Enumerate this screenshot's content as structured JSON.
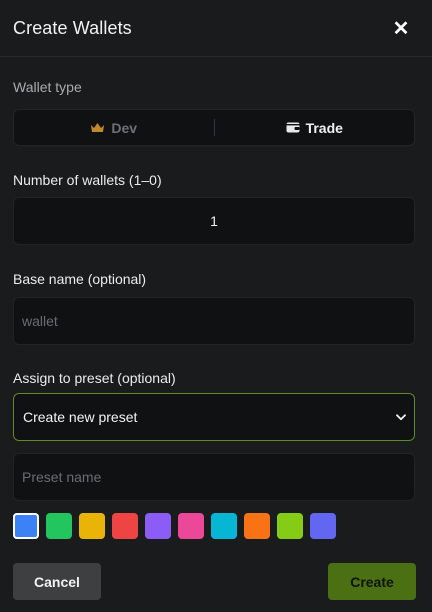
{
  "dialog": {
    "title": "Create Wallets",
    "close_label": "✕"
  },
  "wallet_type": {
    "label": "Wallet type",
    "options": [
      {
        "label": "Dev",
        "icon": "crown-icon",
        "selected": false
      },
      {
        "label": "Trade",
        "icon": "wallet-icon",
        "selected": true
      }
    ]
  },
  "count": {
    "label": "Number of wallets (1–0)",
    "value": "1"
  },
  "base_name": {
    "label": "Base name (optional)",
    "placeholder": "wallet",
    "value": ""
  },
  "preset": {
    "label": "Assign to preset (optional)",
    "selected": "Create new preset",
    "name_placeholder": "Preset name"
  },
  "colors": [
    "#3b82f6",
    "#22c55e",
    "#eab308",
    "#ef4444",
    "#8b5cf6",
    "#ec4899",
    "#06b6d4",
    "#f97316",
    "#84cc16",
    "#6366f1"
  ],
  "selected_color": "#3b82f6",
  "accent_color": "#5f8a27",
  "actions": {
    "cancel": "Cancel",
    "create": "Create"
  }
}
